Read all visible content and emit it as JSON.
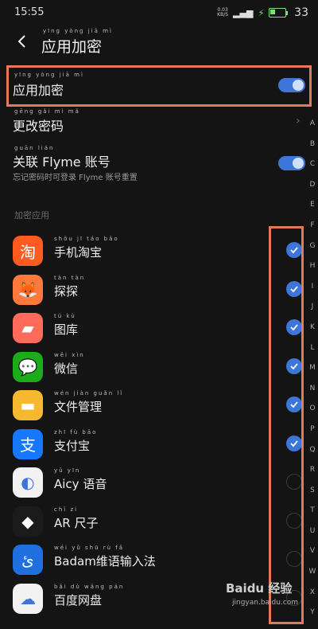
{
  "status": {
    "time": "15:55",
    "net_speed": "0.03",
    "net_unit": "KB/S",
    "battery": "33"
  },
  "header": {
    "title": "应用加密",
    "title_pinyin": "yīng yòng jiā mì"
  },
  "settings": {
    "app_lock": {
      "label": "应用加密",
      "pinyin": "yīng yòng jiā mì",
      "enabled": true
    },
    "change_password": {
      "label": "更改密码",
      "pinyin": "gēng gǎi mì mǎ"
    },
    "flyme_account": {
      "label": "关联 Flyme 账号",
      "pinyin": "guān lián",
      "sub": "忘记密码时可登录 Flyme 账号重置",
      "enabled": true
    }
  },
  "section_label": "加密应用",
  "apps": [
    {
      "name": "手机淘宝",
      "pinyin": "shǒu jī táo bǎo",
      "icon": "taobao-icon",
      "color": "#ff5a1f",
      "checked": true
    },
    {
      "name": "探探",
      "pinyin": "tàn tàn",
      "icon": "tantan-icon",
      "color": "#ff7a3a",
      "checked": true
    },
    {
      "name": "图库",
      "pinyin": "tú kù",
      "icon": "gallery-icon",
      "color": "#ff6b5b",
      "checked": true
    },
    {
      "name": "微信",
      "pinyin": "wēi xìn",
      "icon": "wechat-icon",
      "color": "#1aad19",
      "checked": true
    },
    {
      "name": "文件管理",
      "pinyin": "wén jiàn guǎn lǐ",
      "icon": "folder-icon",
      "color": "#f5b82e",
      "checked": true
    },
    {
      "name": "支付宝",
      "pinyin": "zhī fù bǎo",
      "icon": "alipay-icon",
      "color": "#1677ff",
      "checked": true
    },
    {
      "name": "Aicy 语音",
      "pinyin": "yǔ yīn",
      "icon": "aicy-icon",
      "color": "#f2f2f2",
      "checked": false
    },
    {
      "name": "AR 尺子",
      "pinyin": "chǐ zi",
      "icon": "ar-ruler-icon",
      "color": "#1b1b1b",
      "checked": false
    },
    {
      "name": "Badam维语输入法",
      "pinyin": "wéi yǔ shū rù fǎ",
      "icon": "badam-icon",
      "color": "#1f6fe0",
      "checked": false
    },
    {
      "name": "百度网盘",
      "pinyin": "bǎi dù wǎng pán",
      "icon": "baidu-pan-icon",
      "color": "#f2f2f2",
      "checked": false
    }
  ],
  "alphabet": [
    "A",
    "B",
    "C",
    "D",
    "E",
    "F",
    "G",
    "H",
    "I",
    "J",
    "K",
    "L",
    "M",
    "N",
    "O",
    "P",
    "Q",
    "R",
    "S",
    "T",
    "U",
    "V",
    "W",
    "X",
    "Y"
  ],
  "watermark": {
    "brand": "Baidu 经验",
    "url": "jingyan.baidu.com"
  }
}
